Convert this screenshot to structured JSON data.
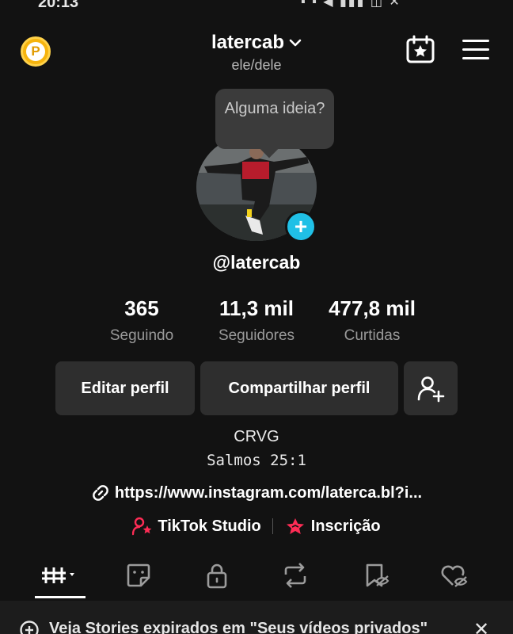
{
  "status_bar": {
    "time": "20:13",
    "icons": [
      "notification-icons",
      "signal-icon",
      "wifi-icon",
      "battery-icon"
    ]
  },
  "header": {
    "username": "latercab",
    "pronouns": "ele/dele"
  },
  "bubble": {
    "text": "Alguma ideia?"
  },
  "profile": {
    "handle": "@latercab"
  },
  "stats": [
    {
      "value": "365",
      "label": "Seguindo"
    },
    {
      "value": "11,3 mil",
      "label": "Seguidores"
    },
    {
      "value": "477,8 mil",
      "label": "Curtidas"
    }
  ],
  "buttons": {
    "edit": "Editar perfil",
    "share": "Compartilhar perfil"
  },
  "bio": {
    "line1": "CRVG",
    "line2": "Salmos 25:1"
  },
  "link": {
    "text": "https://www.instagram.com/laterca.bl?i..."
  },
  "extras": {
    "studio": "TikTok Studio",
    "subscription": "Inscrição"
  },
  "tabs": [
    "videos-grid",
    "reposts-sticker",
    "private-lock",
    "reposts",
    "favorites",
    "liked"
  ],
  "banner": {
    "text": "Veja Stories expirados em \"Seus vídeos privados\""
  },
  "colors": {
    "background": "#121212",
    "accent_cyan": "#20c0e6",
    "accent_red": "#fe2c55",
    "coin": "#f6b40e"
  }
}
